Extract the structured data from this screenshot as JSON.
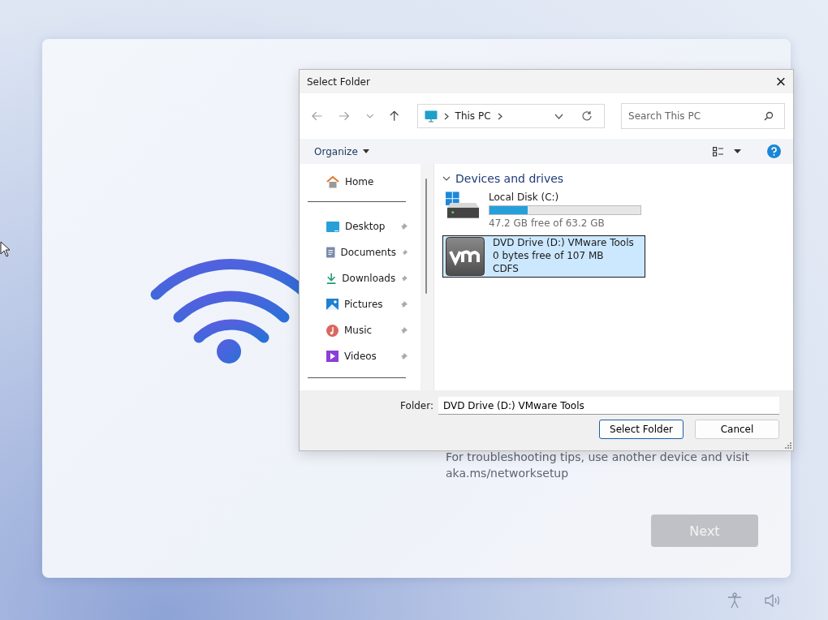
{
  "setup": {
    "help_text": "For troubleshooting tips, use another device and visit aka.ms/networksetup",
    "next_button": {
      "label": "Next",
      "disabled": true
    }
  },
  "dialog": {
    "title": "Select Folder",
    "close_glyph": "×",
    "address": {
      "crumbs": [
        "This PC"
      ]
    },
    "search": {
      "placeholder": "Search This PC"
    },
    "toolbar": {
      "organize": "Organize"
    },
    "nav_pane": {
      "home": "Home",
      "items": [
        {
          "label": "Desktop",
          "kind": "desktop"
        },
        {
          "label": "Documents",
          "kind": "documents"
        },
        {
          "label": "Downloads",
          "kind": "downloads"
        },
        {
          "label": "Pictures",
          "kind": "pictures"
        },
        {
          "label": "Music",
          "kind": "music"
        },
        {
          "label": "Videos",
          "kind": "videos"
        }
      ]
    },
    "group": {
      "title": "Devices and drives",
      "expanded": true,
      "drives": [
        {
          "kind": "disk",
          "name": "Local Disk (C:)",
          "level": 0.25,
          "detail": "47.2 GB free of 63.2 GB",
          "selected": false
        },
        {
          "kind": "dvd",
          "name": "DVD Drive (D:) VMware Tools",
          "detail": "0 bytes free of 107 MB",
          "filesystem": "CDFS",
          "selected": true
        }
      ]
    },
    "folder": {
      "label": "Folder:",
      "value": "DVD Drive (D:) VMware Tools"
    },
    "buttons": [
      {
        "label": "Select Folder",
        "default": true
      },
      {
        "label": "Cancel",
        "default": false
      }
    ]
  }
}
